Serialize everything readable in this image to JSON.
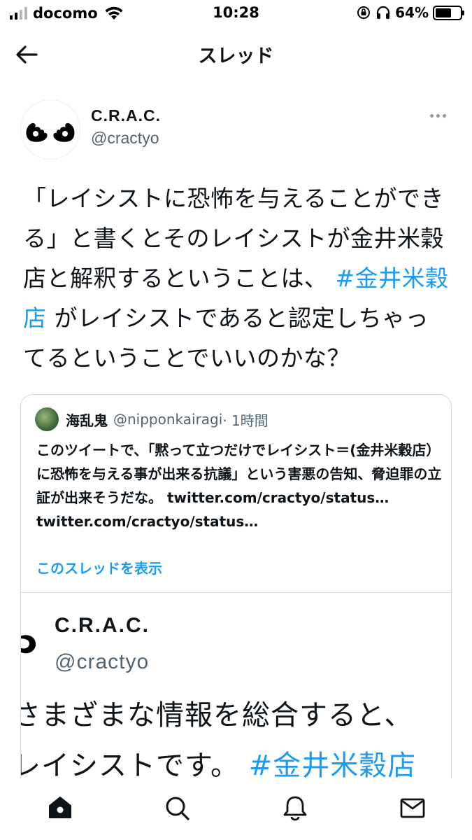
{
  "status_bar": {
    "carrier": "docomo",
    "time": "10:28",
    "battery": "64%",
    "battery_level": 0.64
  },
  "header": {
    "title": "スレッド"
  },
  "tweet": {
    "author_name": "C.R.A.C.",
    "author_handle": "@cractyo",
    "text_part1": "「レイシストに恐怖を与えることができる」と書くとそのレイシストが金井米穀店と解釈するということは、",
    "hashtag": "#金井米穀店",
    "text_part2": "がレイシストであると認定しちゃってるということでいいのかな？"
  },
  "quote": {
    "name": "海乱鬼",
    "handle": "@nipponkairagi",
    "time": "· 1時間",
    "text": "このツイートで、「黙って立つだけでレイシスト＝(金井米穀店）に恐怖を与える事が出来る抗議」という害悪の告知、脅迫罪の立証が出来そうだな。 twitter.com/cractyo/status… twitter.com/cractyo/status…",
    "show_thread": "このスレッドを表示",
    "embed": {
      "name": "C.R.A.C.",
      "handle": "@cractyo",
      "line1": "さまざまな情報を総合すると、",
      "line2_text": "レイシストです。",
      "line2_hashtag": "#金井米穀店"
    }
  },
  "tabbar": {
    "items": [
      "home-icon",
      "search-icon",
      "notifications-icon",
      "messages-icon"
    ]
  }
}
